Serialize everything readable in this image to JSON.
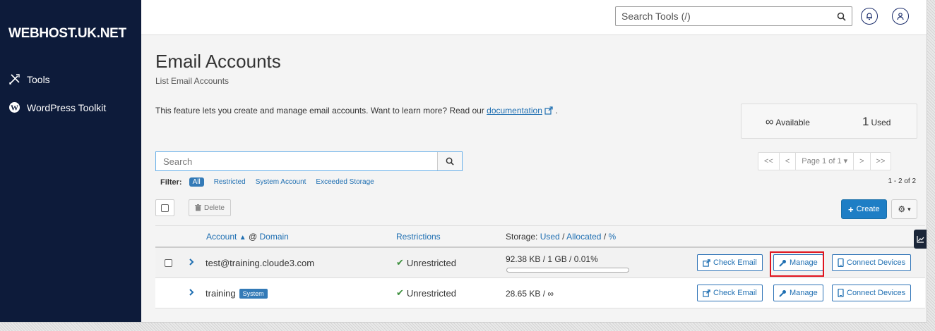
{
  "brand": "WEBHOST.UK.NET",
  "sidebar": {
    "items": [
      {
        "label": "Tools",
        "icon": "tools-icon"
      },
      {
        "label": "WordPress Toolkit",
        "icon": "wordpress-icon"
      }
    ]
  },
  "topbar": {
    "search_placeholder": "Search Tools (/)",
    "icons": [
      "search-icon",
      "bell-icon",
      "user-icon"
    ]
  },
  "page": {
    "title": "Email Accounts",
    "subtitle": "List Email Accounts",
    "description": "This feature lets you create and manage email accounts. Want to learn more? Read our",
    "doc_link": "documentation",
    "desc_end": "."
  },
  "stats": {
    "available_symbol": "∞",
    "available_label": "Available",
    "used_count": "1",
    "used_label": "Used"
  },
  "search": {
    "placeholder": "Search"
  },
  "filter": {
    "label": "Filter:",
    "options": [
      "All",
      "Restricted",
      "System Account",
      "Exceeded Storage"
    ],
    "active": "All"
  },
  "pagination": {
    "first": "<<",
    "prev": "<",
    "page_label": "Page 1 of 1",
    "next": ">",
    "last": ">>",
    "count_text": "1 - 2 of 2"
  },
  "actions": {
    "delete_label": "Delete",
    "create_label": "Create"
  },
  "table": {
    "headers": {
      "account": "Account",
      "at": "@",
      "domain": "Domain",
      "restrictions": "Restrictions",
      "storage_prefix": "Storage:",
      "used": "Used",
      "sep1": "/",
      "allocated": "Allocated",
      "sep2": "/",
      "percent": "%"
    },
    "rows": [
      {
        "account": "test@training.cloude3.com",
        "badge": "",
        "restriction": "Unrestricted",
        "storage": "92.38 KB / 1 GB / 0.01%",
        "usage_percent": 0.01,
        "buttons": [
          "Check Email",
          "Manage",
          "Connect Devices"
        ]
      },
      {
        "account": "training",
        "badge": "System",
        "restriction": "Unrestricted",
        "storage": "28.65 KB / ∞",
        "buttons": [
          "Check Email",
          "Manage",
          "Connect Devices"
        ]
      }
    ]
  },
  "colors": {
    "sidebar_bg": "#0d1b3a",
    "primary": "#337ab7",
    "link": "#1f6fb2",
    "highlight": "#e0141e",
    "success": "#3c8f3c"
  }
}
